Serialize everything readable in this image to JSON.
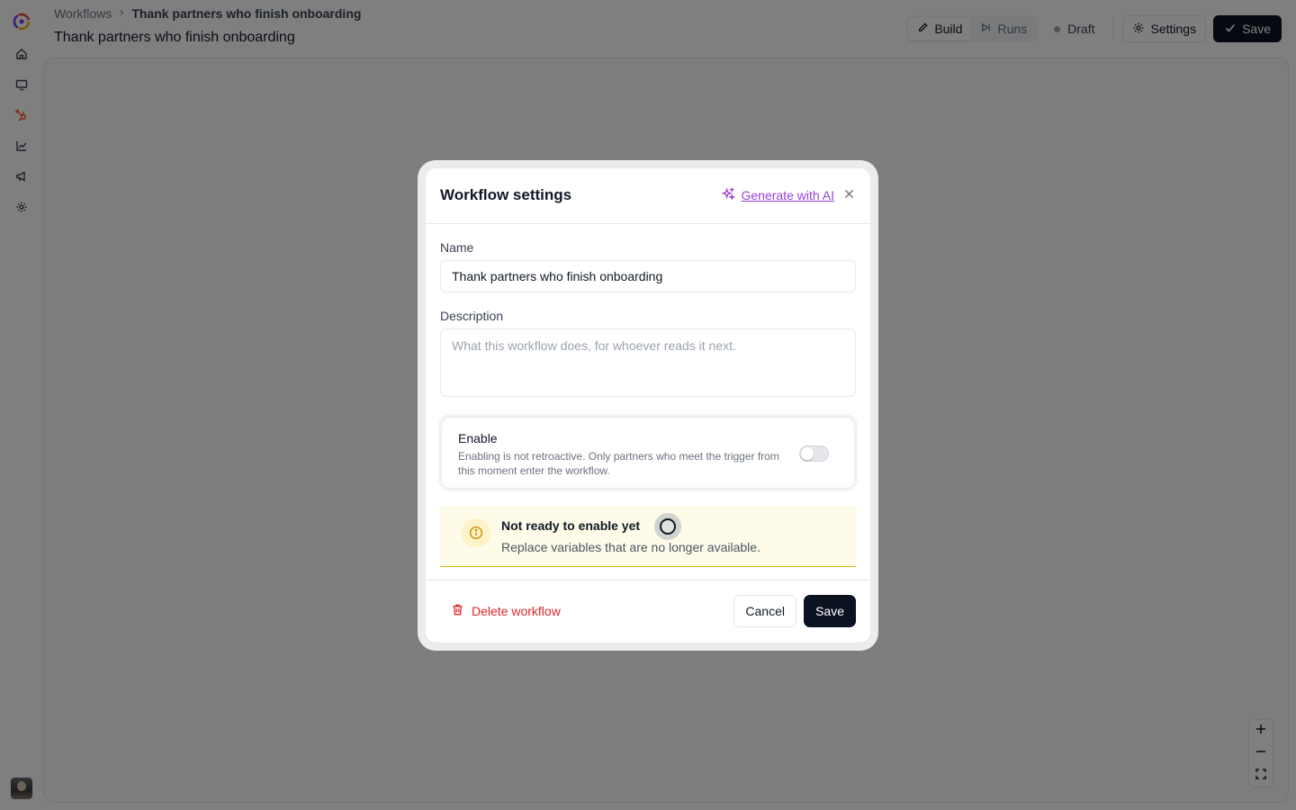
{
  "breadcrumb": {
    "root": "Workflows",
    "current": "Thank partners who finish onboarding"
  },
  "page": {
    "title": "Thank partners who finish onboarding"
  },
  "toolbar": {
    "build_label": "Build",
    "runs_label": "Runs",
    "status_label": "Draft",
    "settings_label": "Settings",
    "save_label": "Save"
  },
  "sidebar": {
    "items": [
      {
        "icon": "home-icon"
      },
      {
        "icon": "monitor-icon"
      },
      {
        "icon": "hubspot-icon"
      },
      {
        "icon": "chart-icon"
      },
      {
        "icon": "megaphone-icon"
      },
      {
        "icon": "gear-icon"
      }
    ]
  },
  "modal": {
    "title": "Workflow settings",
    "ai_link": "Generate with AI",
    "name_label": "Name",
    "name_value": "Thank partners who finish onboarding",
    "description_label": "Description",
    "description_placeholder": "What this workflow does, for whoever reads it next.",
    "enable_title": "Enable",
    "enable_description": "Enabling is not retroactive. Only partners who meet the trigger from this moment enter the workflow.",
    "enabled": false,
    "warning_title": "Not ready to enable yet",
    "warning_description": "Replace variables that are no longer available.",
    "delete_label": "Delete workflow",
    "cancel_label": "Cancel",
    "save_label": "Save"
  },
  "colors": {
    "accent_dark": "#0b1220",
    "ai_purple": "#9b3fd9",
    "danger": "#dc2626",
    "warning_bg": "#fefce8"
  }
}
